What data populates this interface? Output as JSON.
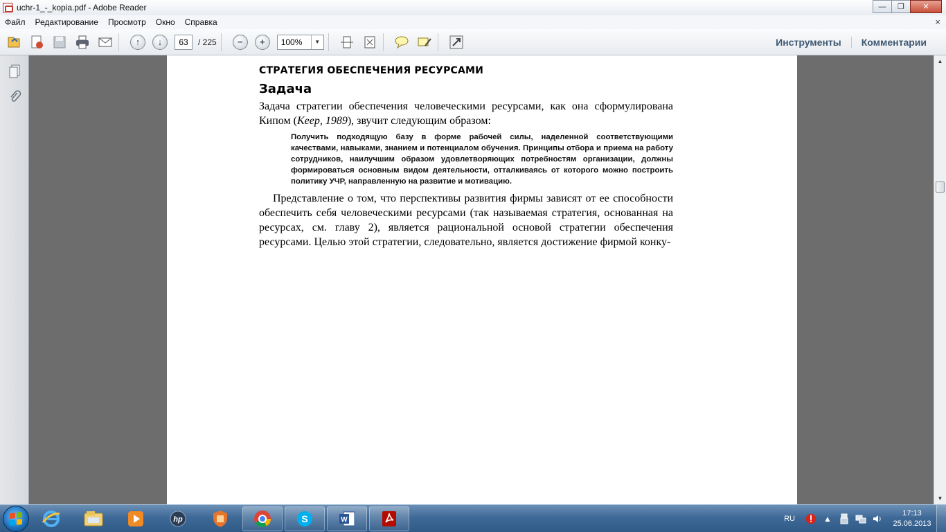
{
  "window": {
    "title": "uchr-1_-_kopia.pdf - Adobe Reader",
    "controls": [
      "minimize",
      "maximize",
      "close"
    ]
  },
  "menu": {
    "items": [
      "Файл",
      "Редактирование",
      "Просмотр",
      "Окно",
      "Справка"
    ],
    "close_glyph": "×"
  },
  "toolbar": {
    "icons": [
      "open-file-icon",
      "create-pdf-icon",
      "save-icon",
      "print-icon",
      "email-icon"
    ],
    "page_current": "63",
    "page_separator_total": "/  225",
    "zoom": "100%",
    "tools_label": "Инструменты",
    "comments_label": "Комментарии"
  },
  "navpanel": {
    "icons": [
      "pages-icon",
      "attachments-icon"
    ]
  },
  "document": {
    "heading": "СТРАТЕГИЯ ОБЕСПЕЧЕНИЯ РЕСУРСАМИ",
    "subheading": "Задача",
    "para1_a": "Задача стратегии обеспечения человеческими ресурсами, как она сформулирована Кипом (",
    "para1_italic": "Keep, 1989",
    "para1_b": "), звучит следующим образом:",
    "quote": "Получить подходящую базу в форме рабочей силы, наделенной соответствующими качествами, навыками, знанием и потенциалом обучения. Принципы отбора и приема на работу сотрудников, наилучшим образом удовлетворяющих потребностям организации, должны формироваться основным видом деятельности, отталкиваясь от которого можно построить политику УЧР, направленную на развитие и мотивацию.",
    "para2": "Представление о том, что перспективы развития фирмы зависят от ее способности обеспечить себя человеческими ресурсами (так называемая стратегия, основанная на ресурсах, см. главу 2), является рациональной основой стратегии обеспечения ресурсами. Целью этой стратегии, следовательно, является достижение фирмой конку-"
  },
  "taskbar": {
    "apps": [
      "internet-explorer",
      "windows-explorer",
      "media-player",
      "hp-app",
      "shield-app",
      "chrome",
      "skype",
      "word",
      "adobe-reader"
    ],
    "language": "RU",
    "time": "17:13",
    "date": "25.06.2013"
  },
  "colors": {
    "accent_link": "#3f5873",
    "taskbar": "#3f6a98",
    "workspace": "#6d6d6d"
  }
}
